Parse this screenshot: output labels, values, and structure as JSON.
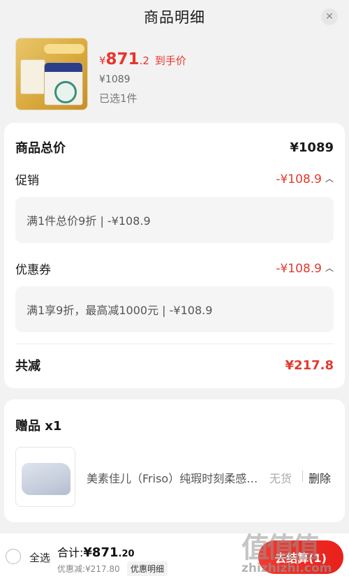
{
  "header": {
    "title": "商品明细",
    "close_icon": "close-icon"
  },
  "product": {
    "price_symbol": "¥",
    "price_integer": "871",
    "price_decimal": ".2",
    "price_tag": "到手价",
    "original_price": "¥1089",
    "selected_count": "已选1件"
  },
  "breakdown": {
    "total_label": "商品总价",
    "total_value": "¥1089",
    "promo_label": "促销",
    "promo_value": "-¥108.9",
    "promo_detail": "满1件总价9折 | -¥108.9",
    "coupon_label": "优惠券",
    "coupon_value": "-¥108.9",
    "coupon_detail": "满1享9折，最高减1000元 | -¥108.9",
    "reduction_label": "共减",
    "reduction_value": "¥217.8"
  },
  "gift": {
    "title": "赠品 x1",
    "name": "美素佳儿（Friso）纯瑕时刻柔感浴巾",
    "status": "无货",
    "delete_label": "删除"
  },
  "bottom_bar": {
    "select_all": "全选",
    "total_label": "合计:",
    "total_amount": "¥871",
    "total_decimal": ".20",
    "discount_text": "优惠减:¥217.80",
    "detail_chip": "优惠明细",
    "checkout_label": "去结算(1)"
  },
  "watermark": {
    "big": "值值值",
    "small": "zhizhizhi.com"
  },
  "colors": {
    "accent_red": "#e2392e",
    "background": "#f2f2f2"
  }
}
